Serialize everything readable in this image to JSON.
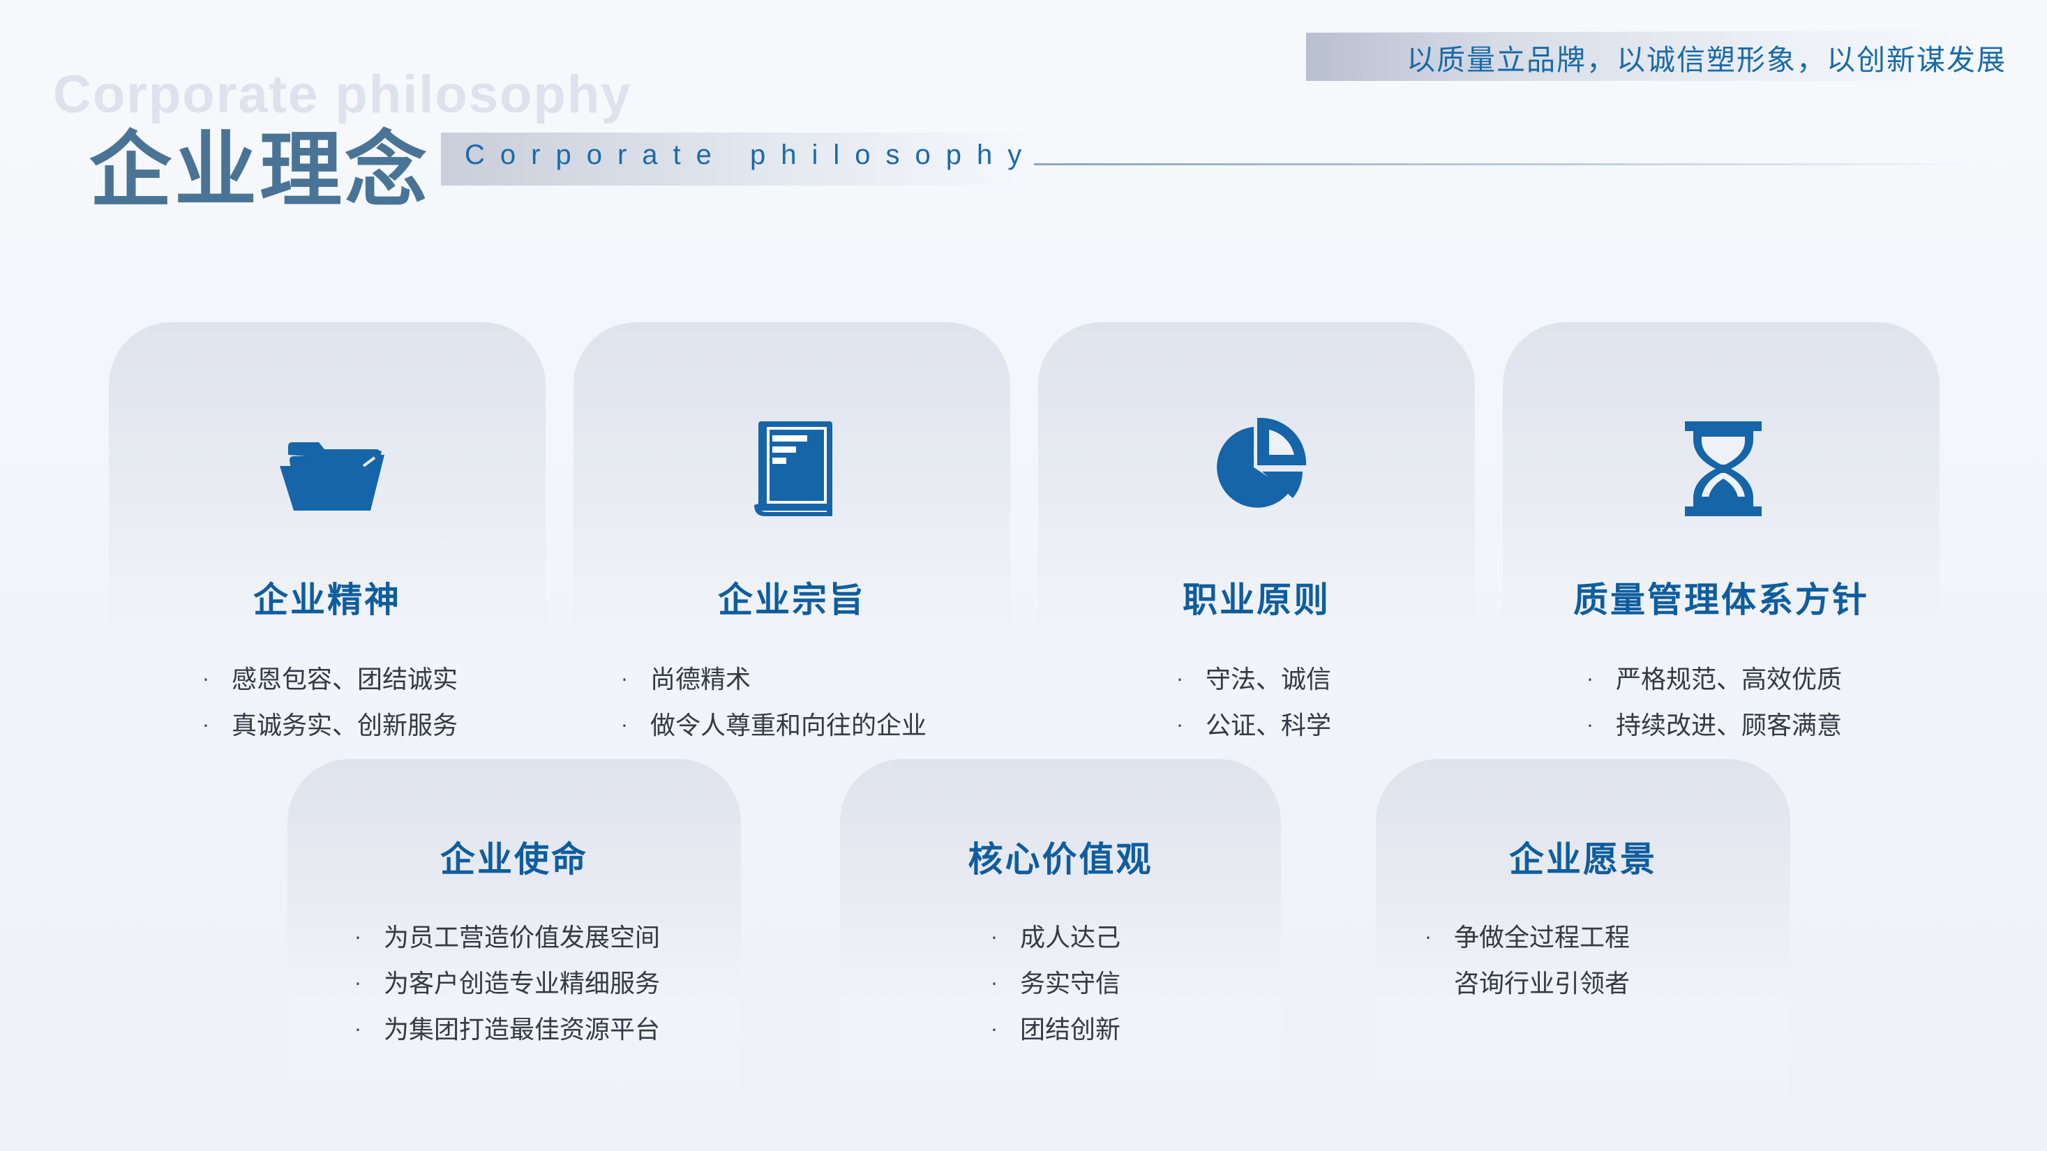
{
  "slogan": "以质量立品牌，以诚信塑形象，以创新谋发展",
  "header": {
    "ghost_title": "Corporate philosophy",
    "title": "企业理念",
    "subtitle": "Corporate philosophy"
  },
  "bullet_char": "·",
  "cards": [
    {
      "icon": "folder-icon",
      "title": "企业精神",
      "items": [
        "感恩包容、团结诚实",
        "真诚务实、创新服务"
      ]
    },
    {
      "icon": "book-icon",
      "title": "企业宗旨",
      "items": [
        "尚德精术",
        "做令人尊重和向往的企业"
      ]
    },
    {
      "icon": "pie-chart-icon",
      "title": "职业原则",
      "items": [
        "守法、诚信",
        "公证、科学"
      ]
    },
    {
      "icon": "hourglass-icon",
      "title": "质量管理体系方针",
      "items": [
        "严格规范、高效优质",
        "持续改进、顾客满意"
      ]
    },
    {
      "title": "企业使命",
      "items": [
        "为员工营造价值发展空间",
        "为客户创造专业精细服务",
        "为集团打造最佳资源平台"
      ]
    },
    {
      "title": "核心价值观",
      "items": [
        "成人达己",
        "务实守信",
        "团结创新"
      ]
    },
    {
      "title": "企业愿景",
      "items": [
        "争做全过程工程",
        "咨询行业引领者"
      ]
    }
  ],
  "colors": {
    "accent": "#0f5d9e",
    "icon": "#1565a8",
    "title_gray_blue": "#4a7496"
  }
}
